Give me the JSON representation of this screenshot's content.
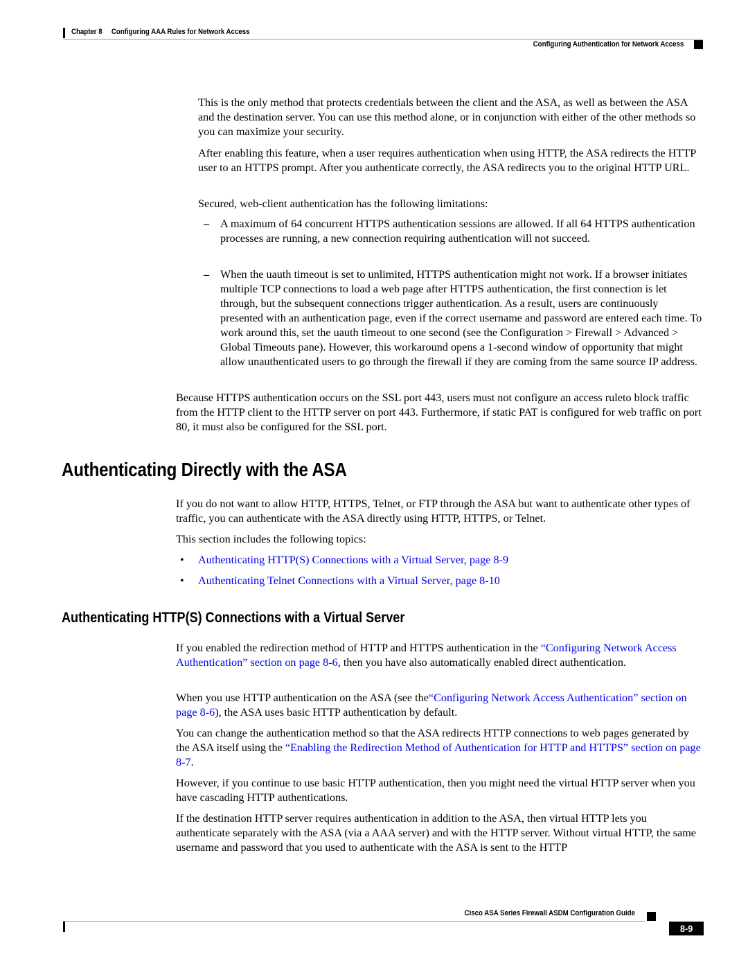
{
  "header": {
    "chapter": "Chapter 8",
    "chapter_title": "Configuring AAA Rules for Network Access",
    "section_title": "Configuring Authentication for Network Access"
  },
  "intro": {
    "p1": "This is the only method that protects credentials between the client and the ASA, as well as between the ASA and the destination server. You can use this method alone, or in conjunction with either of the other methods so you can maximize your security.",
    "p2": "After enabling this feature, when a user requires authentication when using HTTP, the ASA redirects the HTTP user to an HTTPS prompt. After you authenticate correctly, the ASA redirects you to the original HTTP URL.",
    "p3": "Secured, web-client authentication has the following limitations:",
    "limitations": [
      {
        "marker": "–",
        "text": "A maximum of 64 concurrent HTTPS authentication sessions are allowed. If all 64 HTTPS authentication processes are running, a new connection requiring authentication will not succeed."
      },
      {
        "marker": "–",
        "text": "When the uauth timeout is set to unlimited, HTTPS authentication might not work. If a browser initiates multiple TCP connections to load a web page after HTTPS authentication, the first connection is let through, but the subsequent connections trigger authentication. As a result, users are continuously presented with an authentication page, even if the correct username and password are entered each time. To work around this, set the uauth timeout to one second (see the Configuration > Firewall > Advanced > Global Timeouts pane). However, this workaround opens a 1-second window of opportunity that might allow unauthenticated users to go through the firewall if they are coming from the same source IP address."
      }
    ],
    "p4": "Because HTTPS authentication occurs on the SSL port 443, users must not configure an access ruleto block traffic from the HTTP client to the HTTP server on port 443. Furthermore, if static PAT is configured for web traffic on port 80, it must also be configured for the SSL port."
  },
  "section1": {
    "heading": "Authenticating Directly with the ASA",
    "p1": "If you do not want to allow HTTP, HTTPS, Telnet, or FTP through the ASA but want to authenticate other types of traffic, you can authenticate with the ASA directly using HTTP, HTTPS, or Telnet.",
    "p2": "This section includes the following topics:",
    "topics": [
      {
        "marker": "•",
        "label": "Authenticating HTTP(S) Connections with a Virtual Server, page 8-9"
      },
      {
        "marker": "•",
        "label": "Authenticating Telnet Connections with a Virtual Server, page 8-10"
      }
    ]
  },
  "section2": {
    "heading": "Authenticating HTTP(S) Connections with a Virtual Server",
    "p1_before": "If you enabled the redirection method of HTTP and HTTPS authentication in the ",
    "p1_link": "“Configuring Network Access Authentication” section on page 8-6",
    "p1_after": ", then you have also automatically enabled direct authentication.",
    "p2_before": "When you use HTTP authentication on the ASA (see the",
    "p2_link": "“Configuring Network Access Authentication” section on page 8-6",
    "p2_after": "), the ASA uses basic HTTP authentication by default.",
    "p3_before": "You can change the authentication method so that the ASA redirects HTTP connections to web pages generated by the ASA itself using the ",
    "p3_link": "“Enabling the Redirection Method of Authentication for HTTP and HTTPS” section on page 8-7",
    "p3_after": ".",
    "p4": "However, if you continue to use basic HTTP authentication, then you might need the virtual HTTP server when you have cascading HTTP authentications.",
    "p5": "If the destination HTTP server requires authentication in addition to the ASA, then virtual HTTP lets you authenticate separately with the ASA (via a AAA server) and with the HTTP server. Without virtual HTTP, the same username and password that you used to authenticate with the ASA is sent to the HTTP"
  },
  "footer": {
    "guide_title": "Cisco ASA Series Firewall ASDM Configuration Guide",
    "page_number": "8-9"
  },
  "colors": {
    "link": "#0000ee",
    "text": "#000000",
    "rule": "#9a9a9a"
  }
}
